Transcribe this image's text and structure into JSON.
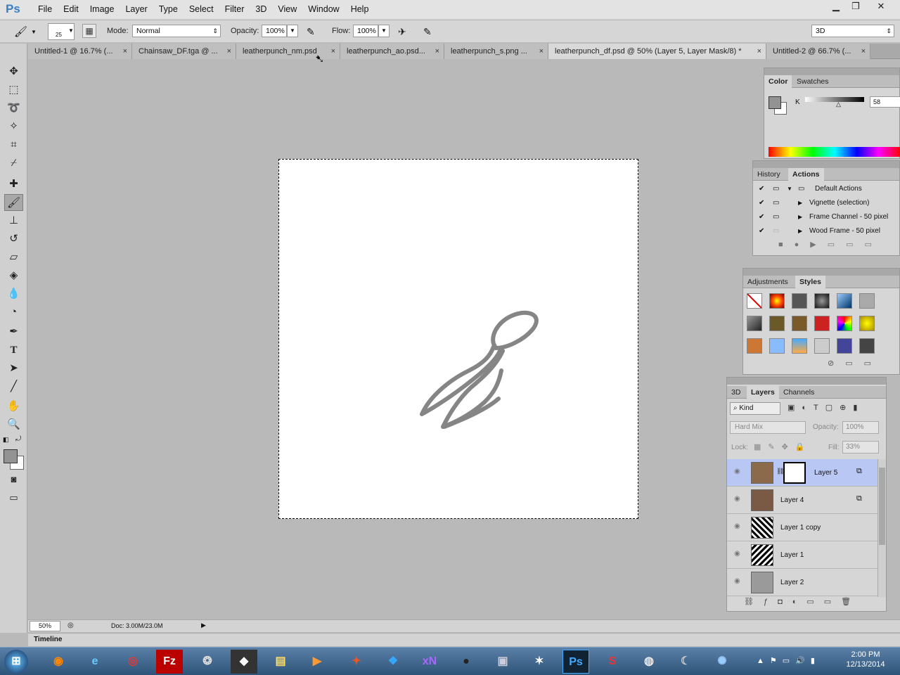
{
  "app": {
    "logo": "Ps"
  },
  "menu": [
    "File",
    "Edit",
    "Image",
    "Layer",
    "Type",
    "Select",
    "Filter",
    "3D",
    "View",
    "Window",
    "Help"
  ],
  "options": {
    "brush_size": "25",
    "mode_label": "Mode:",
    "mode_value": "Normal",
    "opacity_label": "Opacity:",
    "opacity_value": "100%",
    "flow_label": "Flow:",
    "flow_value": "100%",
    "workspace": "3D"
  },
  "tabs": [
    {
      "label": "Untitled-1 @ 16.7% (..."
    },
    {
      "label": "Chainsaw_DF.tga @ ..."
    },
    {
      "label": "leatherpunch_nm.psd"
    },
    {
      "label": "leatherpunch_ao.psd..."
    },
    {
      "label": "leatherpunch_s.png ..."
    },
    {
      "label": "leatherpunch_df.psd @ 50% (Layer 5, Layer Mask/8) *"
    },
    {
      "label": "Untitled-2 @ 66.7% (..."
    }
  ],
  "status": {
    "zoom": "50%",
    "doc": "Doc: 3.00M/23.0M"
  },
  "timeline_label": "Timeline",
  "color_panel": {
    "tabs": [
      "Color",
      "Swatches"
    ],
    "channel": "K",
    "value": "58"
  },
  "history_panel": {
    "tabs": [
      "History",
      "Actions"
    ],
    "items": [
      "Default Actions",
      "Vignette (selection)",
      "Frame Channel - 50 pixel",
      "Wood Frame - 50 pixel"
    ]
  },
  "adjust_panel": {
    "tabs": [
      "Adjustments",
      "Styles"
    ]
  },
  "layers_panel": {
    "tabs": [
      "3D",
      "Layers",
      "Channels"
    ],
    "kind": "Kind",
    "blend": "Hard Mix",
    "opacity_label": "Opacity:",
    "opacity": "100%",
    "lock_label": "Lock:",
    "fill_label": "Fill:",
    "fill": "33%",
    "layers": [
      {
        "name": "Layer 5"
      },
      {
        "name": "Layer 4"
      },
      {
        "name": "Layer 1 copy"
      },
      {
        "name": "Layer 1"
      },
      {
        "name": "Layer 2"
      }
    ]
  },
  "clock": {
    "time": "2:00 PM",
    "date": "12/13/2014"
  },
  "taskbar_icons": [
    "windows-start",
    "firefox",
    "internet-explorer",
    "chrome",
    "filezilla",
    "app",
    "unity",
    "explorer",
    "media-player",
    "app",
    "dropbox",
    "xnview",
    "gimp",
    "virtualbox",
    "zbrush",
    "photoshop",
    "substance",
    "steam",
    "app",
    "app"
  ]
}
